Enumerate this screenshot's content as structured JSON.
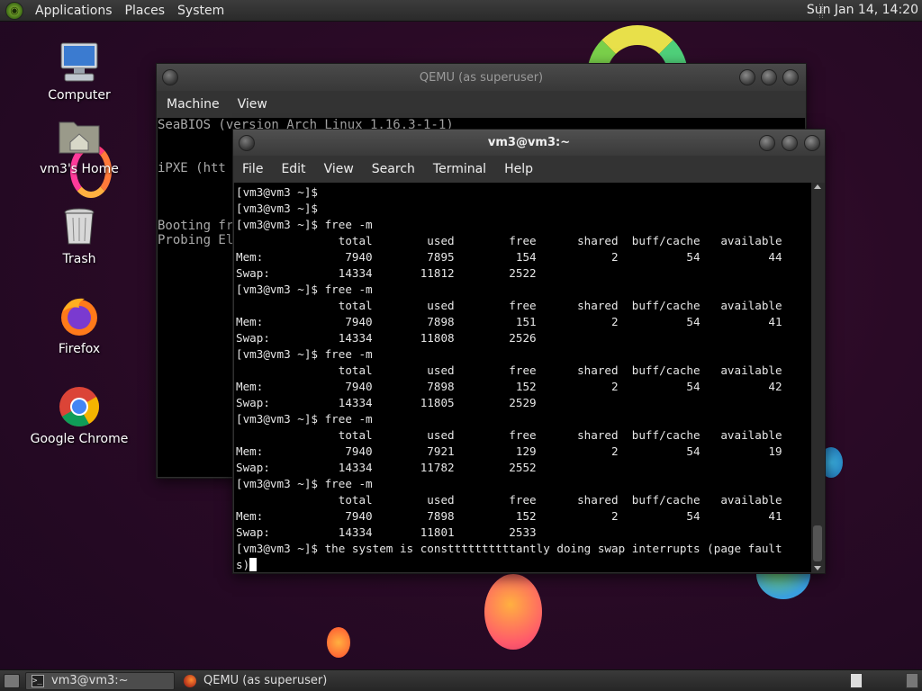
{
  "top_panel": {
    "menus": [
      "Applications",
      "Places",
      "System"
    ],
    "clock": "Sun Jan 14, 14:20"
  },
  "desktop_icons": {
    "computer": "Computer",
    "home": "vm3's Home",
    "trash": "Trash",
    "firefox": "Firefox",
    "chrome": "Google Chrome"
  },
  "qemu_window": {
    "title": "QEMU (as superuser)",
    "menus": [
      "Machine",
      "View"
    ],
    "screen_lines": [
      "SeaBIOS (version Arch Linux 1.16.3-1-1)",
      "",
      "",
      "iPXE (htt",
      "",
      "",
      "",
      "Booting fr",
      "Probing El"
    ]
  },
  "terminal_window": {
    "title": "vm3@vm3:~",
    "menus": [
      "File",
      "Edit",
      "View",
      "Search",
      "Terminal",
      "Help"
    ],
    "lines": [
      "[vm3@vm3 ~]$",
      "[vm3@vm3 ~]$",
      "[vm3@vm3 ~]$ free -m",
      "               total        used        free      shared  buff/cache   available",
      "Mem:            7940        7895         154           2          54          44",
      "Swap:          14334       11812        2522",
      "[vm3@vm3 ~]$ free -m",
      "               total        used        free      shared  buff/cache   available",
      "Mem:            7940        7898         151           2          54          41",
      "Swap:          14334       11808        2526",
      "[vm3@vm3 ~]$ free -m",
      "               total        used        free      shared  buff/cache   available",
      "Mem:            7940        7898         152           2          54          42",
      "Swap:          14334       11805        2529",
      "[vm3@vm3 ~]$ free -m",
      "               total        used        free      shared  buff/cache   available",
      "Mem:            7940        7921         129           2          54          19",
      "Swap:          14334       11782        2552",
      "[vm3@vm3 ~]$ free -m",
      "               total        used        free      shared  buff/cache   available",
      "Mem:            7940        7898         152           2          54          41",
      "Swap:          14334       11801        2533",
      "[vm3@vm3 ~]$ the system is consttttttttttantly doing swap interrupts (page fault"
    ],
    "last_line": "s)"
  },
  "taskbar": {
    "tasks": [
      {
        "label": "vm3@vm3:~",
        "active": true,
        "icon": "terminal-icon"
      },
      {
        "label": "QEMU (as superuser)",
        "active": false,
        "icon": "qemu-icon"
      }
    ]
  },
  "colors": {
    "wallpaper": "#2a0a26",
    "panel": "#333333",
    "terminal_bg": "#000000",
    "terminal_fg": "#e6e6e6"
  }
}
